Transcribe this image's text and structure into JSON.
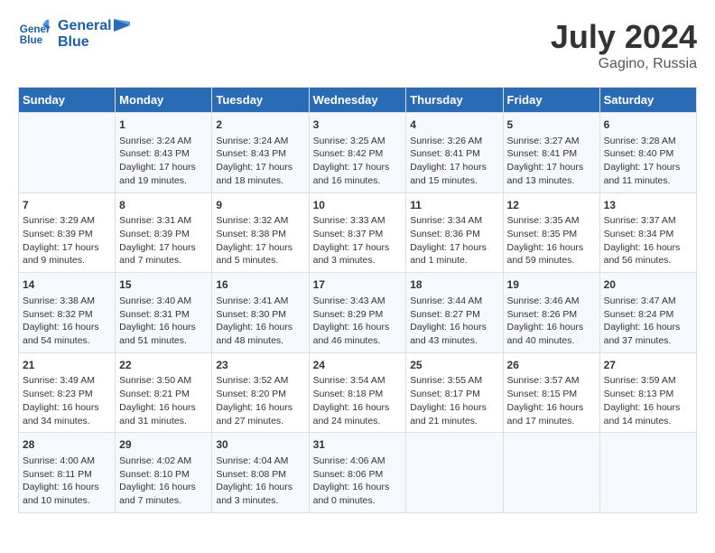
{
  "header": {
    "logo_line1": "General",
    "logo_line2": "Blue",
    "month_year": "July 2024",
    "location": "Gagino, Russia"
  },
  "weekdays": [
    "Sunday",
    "Monday",
    "Tuesday",
    "Wednesday",
    "Thursday",
    "Friday",
    "Saturday"
  ],
  "weeks": [
    [
      {
        "day": "",
        "info": ""
      },
      {
        "day": "1",
        "info": "Sunrise: 3:24 AM\nSunset: 8:43 PM\nDaylight: 17 hours\nand 19 minutes."
      },
      {
        "day": "2",
        "info": "Sunrise: 3:24 AM\nSunset: 8:43 PM\nDaylight: 17 hours\nand 18 minutes."
      },
      {
        "day": "3",
        "info": "Sunrise: 3:25 AM\nSunset: 8:42 PM\nDaylight: 17 hours\nand 16 minutes."
      },
      {
        "day": "4",
        "info": "Sunrise: 3:26 AM\nSunset: 8:41 PM\nDaylight: 17 hours\nand 15 minutes."
      },
      {
        "day": "5",
        "info": "Sunrise: 3:27 AM\nSunset: 8:41 PM\nDaylight: 17 hours\nand 13 minutes."
      },
      {
        "day": "6",
        "info": "Sunrise: 3:28 AM\nSunset: 8:40 PM\nDaylight: 17 hours\nand 11 minutes."
      }
    ],
    [
      {
        "day": "7",
        "info": "Sunrise: 3:29 AM\nSunset: 8:39 PM\nDaylight: 17 hours\nand 9 minutes."
      },
      {
        "day": "8",
        "info": "Sunrise: 3:31 AM\nSunset: 8:39 PM\nDaylight: 17 hours\nand 7 minutes."
      },
      {
        "day": "9",
        "info": "Sunrise: 3:32 AM\nSunset: 8:38 PM\nDaylight: 17 hours\nand 5 minutes."
      },
      {
        "day": "10",
        "info": "Sunrise: 3:33 AM\nSunset: 8:37 PM\nDaylight: 17 hours\nand 3 minutes."
      },
      {
        "day": "11",
        "info": "Sunrise: 3:34 AM\nSunset: 8:36 PM\nDaylight: 17 hours\nand 1 minute."
      },
      {
        "day": "12",
        "info": "Sunrise: 3:35 AM\nSunset: 8:35 PM\nDaylight: 16 hours\nand 59 minutes."
      },
      {
        "day": "13",
        "info": "Sunrise: 3:37 AM\nSunset: 8:34 PM\nDaylight: 16 hours\nand 56 minutes."
      }
    ],
    [
      {
        "day": "14",
        "info": "Sunrise: 3:38 AM\nSunset: 8:32 PM\nDaylight: 16 hours\nand 54 minutes."
      },
      {
        "day": "15",
        "info": "Sunrise: 3:40 AM\nSunset: 8:31 PM\nDaylight: 16 hours\nand 51 minutes."
      },
      {
        "day": "16",
        "info": "Sunrise: 3:41 AM\nSunset: 8:30 PM\nDaylight: 16 hours\nand 48 minutes."
      },
      {
        "day": "17",
        "info": "Sunrise: 3:43 AM\nSunset: 8:29 PM\nDaylight: 16 hours\nand 46 minutes."
      },
      {
        "day": "18",
        "info": "Sunrise: 3:44 AM\nSunset: 8:27 PM\nDaylight: 16 hours\nand 43 minutes."
      },
      {
        "day": "19",
        "info": "Sunrise: 3:46 AM\nSunset: 8:26 PM\nDaylight: 16 hours\nand 40 minutes."
      },
      {
        "day": "20",
        "info": "Sunrise: 3:47 AM\nSunset: 8:24 PM\nDaylight: 16 hours\nand 37 minutes."
      }
    ],
    [
      {
        "day": "21",
        "info": "Sunrise: 3:49 AM\nSunset: 8:23 PM\nDaylight: 16 hours\nand 34 minutes."
      },
      {
        "day": "22",
        "info": "Sunrise: 3:50 AM\nSunset: 8:21 PM\nDaylight: 16 hours\nand 31 minutes."
      },
      {
        "day": "23",
        "info": "Sunrise: 3:52 AM\nSunset: 8:20 PM\nDaylight: 16 hours\nand 27 minutes."
      },
      {
        "day": "24",
        "info": "Sunrise: 3:54 AM\nSunset: 8:18 PM\nDaylight: 16 hours\nand 24 minutes."
      },
      {
        "day": "25",
        "info": "Sunrise: 3:55 AM\nSunset: 8:17 PM\nDaylight: 16 hours\nand 21 minutes."
      },
      {
        "day": "26",
        "info": "Sunrise: 3:57 AM\nSunset: 8:15 PM\nDaylight: 16 hours\nand 17 minutes."
      },
      {
        "day": "27",
        "info": "Sunrise: 3:59 AM\nSunset: 8:13 PM\nDaylight: 16 hours\nand 14 minutes."
      }
    ],
    [
      {
        "day": "28",
        "info": "Sunrise: 4:00 AM\nSunset: 8:11 PM\nDaylight: 16 hours\nand 10 minutes."
      },
      {
        "day": "29",
        "info": "Sunrise: 4:02 AM\nSunset: 8:10 PM\nDaylight: 16 hours\nand 7 minutes."
      },
      {
        "day": "30",
        "info": "Sunrise: 4:04 AM\nSunset: 8:08 PM\nDaylight: 16 hours\nand 3 minutes."
      },
      {
        "day": "31",
        "info": "Sunrise: 4:06 AM\nSunset: 8:06 PM\nDaylight: 16 hours\nand 0 minutes."
      },
      {
        "day": "",
        "info": ""
      },
      {
        "day": "",
        "info": ""
      },
      {
        "day": "",
        "info": ""
      }
    ]
  ]
}
